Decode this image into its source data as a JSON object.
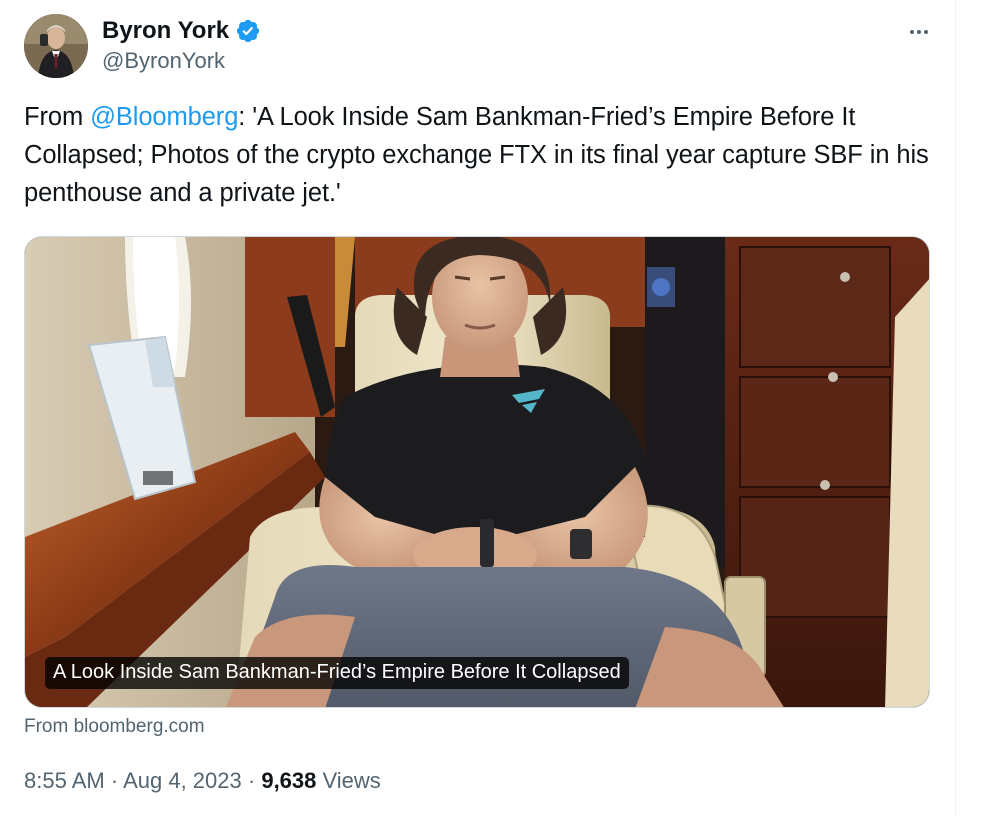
{
  "author": {
    "display_name": "Byron York",
    "handle": "@ByronYork",
    "verified_color": "#1d9bf0"
  },
  "tweet": {
    "text_prefix": "From ",
    "mention": "@Bloomberg",
    "text_body": ": 'A Look Inside Sam Bankman-Fried’s Empire Before It Collapsed; Photos of the crypto exchange FTX in its final year capture SBF in his penthouse and a private jet.'"
  },
  "card": {
    "caption": "A Look Inside Sam Bankman-Fried’s Empire Before It Collapsed",
    "source": "From bloomberg.com"
  },
  "meta": {
    "time": "8:55 AM",
    "separator": "·",
    "date": "Aug 4, 2023",
    "views_count": "9,638",
    "views_label": "Views"
  },
  "icons": {
    "verified": "verified-badge-icon",
    "more": "more-options-icon"
  },
  "colors": {
    "accent": "#1d9bf0",
    "secondary_text": "#536471",
    "primary_text": "#0f1419"
  }
}
